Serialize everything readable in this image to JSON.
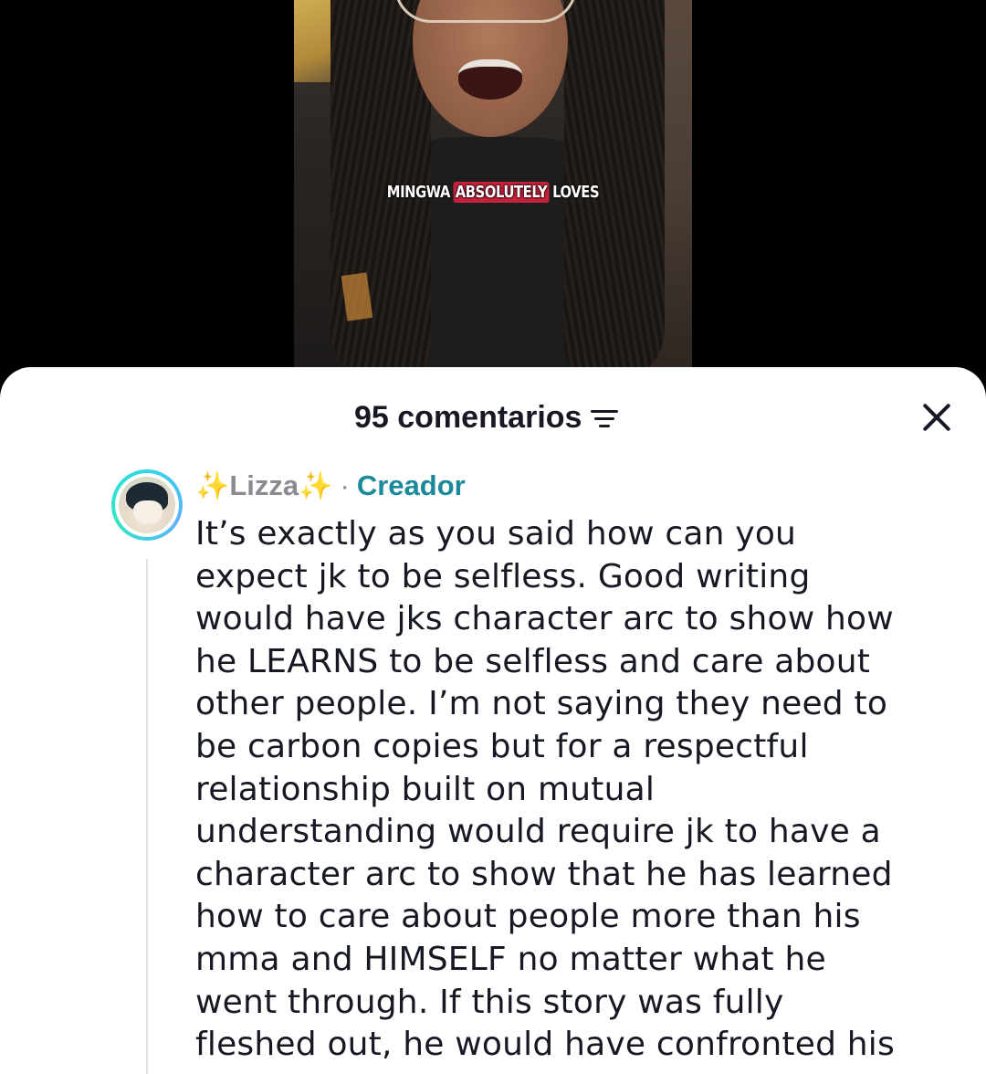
{
  "video": {
    "caption_words": [
      "MINGWA",
      "ABSOLUTELY",
      "LOVES"
    ],
    "highlight_color": "#c7223b"
  },
  "comments_sheet": {
    "count_label": "95 comentarios",
    "filter_icon": "filter-icon",
    "close_icon": "close-icon"
  },
  "comment": {
    "author": "Lizza",
    "author_decoration": "✨",
    "separator": "·",
    "badge": "Creador",
    "badge_color": "#1a8a9a",
    "avatar_ring_color": "#2fd6e8",
    "text_lines": [
      "It’s exactly as you said how can you",
      "expect jk to be selfless. Good writing",
      "would have jks character arc to show how",
      "he LEARNS to be selfless and care about",
      "other people. I’m not saying they need to",
      "be carbon copies but for a respectful",
      "relationship built on mutual",
      "understanding would require jk to have a",
      "character arc to show that he has learned",
      "how to care about people more than his",
      "mma and HIMSELF no matter what he",
      "went through. If this story was fully",
      "fleshed out, he would have confronted his"
    ]
  }
}
